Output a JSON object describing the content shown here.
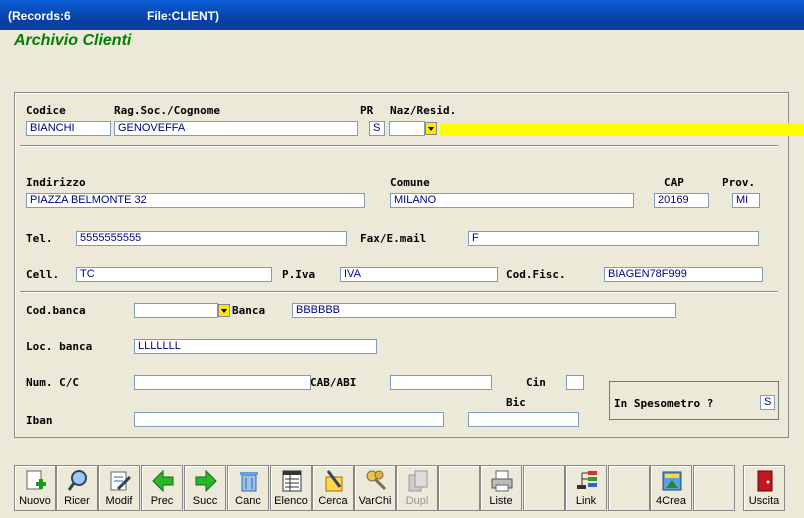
{
  "titlebar": {
    "records": "(Records:6",
    "file": "File:CLIENT)"
  },
  "form": {
    "title": "Archivio Clienti"
  },
  "labels": {
    "codice": "Codice",
    "ragsoc": "Rag.Soc./Cognome",
    "pr": "PR",
    "naz": "Naz/Resid.",
    "indirizzo": "Indirizzo",
    "comune": "Comune",
    "cap": "CAP",
    "prov": "Prov.",
    "tel": "Tel.",
    "fax": "Fax/E.mail",
    "cell": "Cell.",
    "piva": "P.Iva",
    "codfisc": "Cod.Fisc.",
    "codbanca": "Cod.banca",
    "banca": "Banca",
    "locbanca": "Loc. banca",
    "numcc": "Num. C/C",
    "cababi": "CAB/ABI",
    "cin": "Cin",
    "bic": "Bic",
    "iban": "Iban",
    "spesometro": "In Spesometro ?"
  },
  "values": {
    "codice": "BIANCHI",
    "ragsoc": "GENOVEFFA",
    "pr": "S",
    "naz": "",
    "indirizzo": "PIAZZA BELMONTE 32",
    "comune": "MILANO",
    "cap": "20169",
    "prov": "MI",
    "tel": "5555555555",
    "fax": "F",
    "cell": "TC",
    "piva": "IVA",
    "codfisc": "BIAGEN78F999",
    "codbanca": "",
    "banca": "BBBBBB",
    "locbanca": "LLLLLLL",
    "numcc": "",
    "cababi": "",
    "cin": "",
    "bic": "",
    "iban": "",
    "spesometro": "S"
  },
  "toolbar": [
    {
      "label": "Nuovo",
      "icon": "new-record-icon"
    },
    {
      "label": "Ricer",
      "icon": "search-icon"
    },
    {
      "label": "Modif",
      "icon": "edit-icon"
    },
    {
      "label": "Prec",
      "icon": "arrow-left-icon"
    },
    {
      "label": "Succ",
      "icon": "arrow-right-icon"
    },
    {
      "label": "Canc",
      "icon": "trash-icon"
    },
    {
      "label": "Elenco",
      "icon": "list-icon"
    },
    {
      "label": "Cerca",
      "icon": "find-icon"
    },
    {
      "label": "VarChi",
      "icon": "keys-icon"
    },
    {
      "label": "Dupl",
      "icon": "duplicate-icon"
    },
    {
      "label": "",
      "icon": ""
    },
    {
      "label": "Liste",
      "icon": "printer-icon"
    },
    {
      "label": "",
      "icon": ""
    },
    {
      "label": "Link",
      "icon": "link-tree-icon"
    },
    {
      "label": "",
      "icon": ""
    },
    {
      "label": "4Crea",
      "icon": "create-icon"
    },
    {
      "label": "",
      "icon": ""
    },
    {
      "label": "Uscita",
      "icon": "exit-door-icon"
    }
  ],
  "colors": {
    "title_green": "#008000",
    "field_text": "#00007f",
    "highlight_yellow": "#ffff00"
  }
}
